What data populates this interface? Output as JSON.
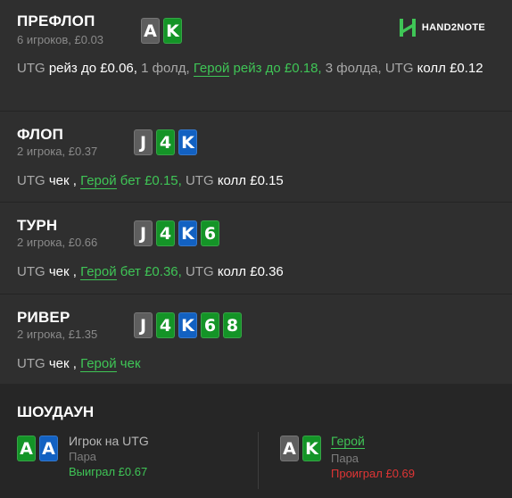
{
  "logo": {
    "text": "HAND2NOTE"
  },
  "preflop": {
    "title": "ПРЕФЛОП",
    "sub": "6 игроков, £0.03",
    "cards": [
      {
        "rank": "A",
        "color": "grey"
      },
      {
        "rank": "K",
        "color": "green"
      }
    ],
    "actions": {
      "a1": "UTG",
      "a2": "рейз до £0.06,",
      "a3": "1 фолд,",
      "a4": "Герой",
      "a5": "рейз до £0.18,",
      "a6": "3 фолда,",
      "a7": "UTG",
      "a8": "колл",
      "a9": "£0.12"
    }
  },
  "flop": {
    "title": "ФЛОП",
    "sub": "2 игрока, £0.37",
    "cards": [
      {
        "rank": "J",
        "color": "grey"
      },
      {
        "rank": "4",
        "color": "green"
      },
      {
        "rank": "K",
        "color": "blue"
      }
    ],
    "actions": {
      "a1": "UTG",
      "a2": "чек ,",
      "a3": "Герой",
      "a4": "бет £0.15,",
      "a5": "UTG",
      "a6": "колл £0.15"
    }
  },
  "turn": {
    "title": "ТУРН",
    "sub": "2 игрока, £0.66",
    "cards": [
      {
        "rank": "J",
        "color": "grey"
      },
      {
        "rank": "4",
        "color": "green"
      },
      {
        "rank": "K",
        "color": "blue"
      },
      {
        "rank": "6",
        "color": "green"
      }
    ],
    "actions": {
      "a1": "UTG",
      "a2": "чек ,",
      "a3": "Герой",
      "a4": "бет £0.36,",
      "a5": "UTG",
      "a6": "колл £0.36"
    }
  },
  "river": {
    "title": "РИВЕР",
    "sub": "2 игрока, £1.35",
    "cards": [
      {
        "rank": "J",
        "color": "grey"
      },
      {
        "rank": "4",
        "color": "green"
      },
      {
        "rank": "K",
        "color": "blue"
      },
      {
        "rank": "6",
        "color": "green"
      },
      {
        "rank": "8",
        "color": "green"
      }
    ],
    "actions": {
      "a1": "UTG",
      "a2": "чек ,",
      "a3": "Герой",
      "a4": "чек"
    }
  },
  "showdown": {
    "title": "ШОУДАУН",
    "villain": {
      "cards": [
        {
          "rank": "A",
          "color": "green"
        },
        {
          "rank": "A",
          "color": "blue"
        }
      ],
      "name": "Игрок на UTG",
      "hand": "Пара",
      "result": "Выиграл £0.67"
    },
    "hero": {
      "cards": [
        {
          "rank": "A",
          "color": "grey"
        },
        {
          "rank": "K",
          "color": "green"
        }
      ],
      "name": "Герой",
      "hand": "Пара",
      "result": "Проиграл £0.69"
    }
  },
  "colors": {
    "background": "#2f2f2f",
    "showdown_bg": "#262626",
    "card_grey": "#5e5e5e",
    "card_green": "#149427",
    "card_blue": "#1261c2",
    "hero": "#3fc556",
    "lost": "#e03535"
  }
}
